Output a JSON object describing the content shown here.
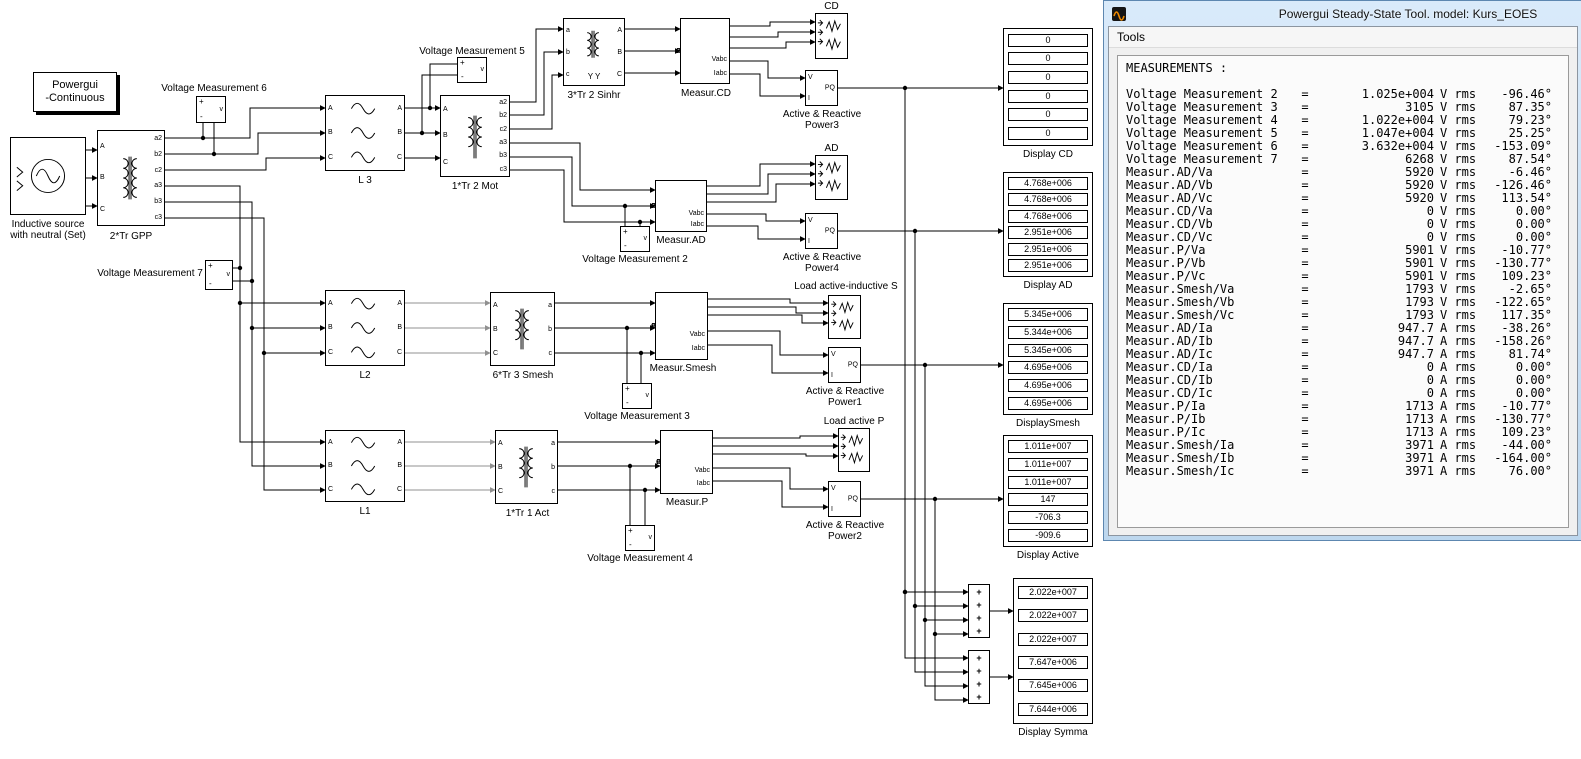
{
  "diagram": {
    "powergui": {
      "line1": "Powergui",
      "line2": "-Continuous"
    },
    "source": {
      "line1": "Inductive source",
      "line2": "with neutral (Set)"
    },
    "gpp": {
      "label": "2*Tr GPP"
    },
    "abc": [
      "A",
      "B",
      "C"
    ],
    "abc_lower": [
      "a",
      "b",
      "c"
    ],
    "tr6": [
      "a2",
      "b2",
      "c2",
      "a3",
      "b3",
      "c3"
    ],
    "vm_pins": {
      "plus": "+",
      "minus": "-",
      "out": "v"
    },
    "vm2_label": "Voltage Measurement 2",
    "vm3_label": "Voltage Measurement 3",
    "vm4_label": "Voltage Measurement 4",
    "vm5_label": "Voltage Measurement 5",
    "vm6_label": "Voltage Measurement 6",
    "vm7_label": "Voltage Measurement 7",
    "l3_label": "L 3",
    "l2_label": "L2",
    "l1_label": "L1",
    "tr2mot": {
      "label": "1*Tr 2 Mot"
    },
    "tr2sinhr": {
      "label": "3*Tr 2 Sinhr",
      "winding": "Y Y"
    },
    "tr3smesh": {
      "label": "6*Tr 3 Smesh"
    },
    "tr1act": {
      "label": "1*Tr 1 Act"
    },
    "measur_pins": {
      "vabc": "Vabc",
      "iabc": "Iabc"
    },
    "measur_cd_label": "Measur.CD",
    "measur_ad_label": "Measur.AD",
    "measur_smesh_label": "Measur.Smesh",
    "measur_p_label": "Measur.P",
    "scope_cd_label": "CD",
    "scope_ad_label": "AD",
    "load_s_label": "Load active-inductive  S",
    "load_p_label": "Load active P",
    "power_pins": {
      "v": "V",
      "i": "I",
      "pq": "PQ"
    },
    "power1": {
      "line1": "Active & Reactive",
      "line2": "Power1"
    },
    "power2": {
      "line1": "Active & Reactive",
      "line2": "Power2"
    },
    "power3": {
      "line1": "Active & Reactive",
      "line2": "Power3"
    },
    "power4": {
      "line1": "Active & Reactive",
      "line2": "Power4"
    },
    "sum_signs": [
      "+",
      "+",
      "+",
      "+"
    ]
  },
  "displays": {
    "cd": {
      "label": "Display CD",
      "values": [
        "0",
        "0",
        "0",
        "0",
        "0",
        "0"
      ]
    },
    "ad": {
      "label": "Display AD",
      "values": [
        "4.768e+006",
        "4.768e+006",
        "4.768e+006",
        "2.951e+006",
        "2.951e+006",
        "2.951e+006"
      ]
    },
    "smesh": {
      "label": "DisplaySmesh",
      "values": [
        "5.345e+006",
        "5.344e+006",
        "5.345e+006",
        "4.695e+006",
        "4.695e+006",
        "4.695e+006"
      ]
    },
    "active": {
      "label": "Display Active",
      "values": [
        "1.011e+007",
        "1.011e+007",
        "1.011e+007",
        "147",
        "-706.3",
        "-909.6"
      ]
    },
    "symma": {
      "label": "Display Symma",
      "values": [
        "2.022e+007",
        "2.022e+007",
        "2.022e+007",
        "7.647e+006",
        "7.645e+006",
        "7.644e+006"
      ]
    }
  },
  "tool_window": {
    "title": "Powergui Steady-State Tool. model: Kurs_EOES",
    "menu_items": [
      "Tools"
    ],
    "header": "MEASUREMENTS :",
    "eq": "=",
    "measurements": [
      {
        "name": "Voltage Measurement 2",
        "value": "1.025e+004",
        "unit": "V rms",
        "angle": "-96.46°"
      },
      {
        "name": "Voltage Measurement 3",
        "value": "3105",
        "unit": "V rms",
        "angle": "87.35°"
      },
      {
        "name": "Voltage Measurement 4",
        "value": "1.022e+004",
        "unit": "V rms",
        "angle": "79.23°"
      },
      {
        "name": "Voltage Measurement 5",
        "value": "1.047e+004",
        "unit": "V rms",
        "angle": "25.25°"
      },
      {
        "name": "Voltage Measurement 6",
        "value": "3.632e+004",
        "unit": "V rms",
        "angle": "-153.09°"
      },
      {
        "name": "Voltage Measurement 7",
        "value": "6268",
        "unit": "V rms",
        "angle": "87.54°"
      },
      {
        "name": "Measur.AD/Va",
        "value": "5920",
        "unit": "V rms",
        "angle": "-6.46°"
      },
      {
        "name": "Measur.AD/Vb",
        "value": "5920",
        "unit": "V rms",
        "angle": "-126.46°"
      },
      {
        "name": "Measur.AD/Vc",
        "value": "5920",
        "unit": "V rms",
        "angle": "113.54°"
      },
      {
        "name": "Measur.CD/Va",
        "value": "0",
        "unit": "V rms",
        "angle": "0.00°"
      },
      {
        "name": "Measur.CD/Vb",
        "value": "0",
        "unit": "V rms",
        "angle": "0.00°"
      },
      {
        "name": "Measur.CD/Vc",
        "value": "0",
        "unit": "V rms",
        "angle": "0.00°"
      },
      {
        "name": "Measur.P/Va",
        "value": "5901",
        "unit": "V rms",
        "angle": "-10.77°"
      },
      {
        "name": "Measur.P/Vb",
        "value": "5901",
        "unit": "V rms",
        "angle": "-130.77°"
      },
      {
        "name": "Measur.P/Vc",
        "value": "5901",
        "unit": "V rms",
        "angle": "109.23°"
      },
      {
        "name": "Measur.Smesh/Va",
        "value": "1793",
        "unit": "V rms",
        "angle": "-2.65°"
      },
      {
        "name": "Measur.Smesh/Vb",
        "value": "1793",
        "unit": "V rms",
        "angle": "-122.65°"
      },
      {
        "name": "Measur.Smesh/Vc",
        "value": "1793",
        "unit": "V rms",
        "angle": "117.35°"
      },
      {
        "name": "Measur.AD/Ia",
        "value": "947.7",
        "unit": "A rms",
        "angle": "-38.26°"
      },
      {
        "name": "Measur.AD/Ib",
        "value": "947.7",
        "unit": "A rms",
        "angle": "-158.26°"
      },
      {
        "name": "Measur.AD/Ic",
        "value": "947.7",
        "unit": "A rms",
        "angle": "81.74°"
      },
      {
        "name": "Measur.CD/Ia",
        "value": "0",
        "unit": "A rms",
        "angle": "0.00°"
      },
      {
        "name": "Measur.CD/Ib",
        "value": "0",
        "unit": "A rms",
        "angle": "0.00°"
      },
      {
        "name": "Measur.CD/Ic",
        "value": "0",
        "unit": "A rms",
        "angle": "0.00°"
      },
      {
        "name": "Measur.P/Ia",
        "value": "1713",
        "unit": "A rms",
        "angle": "-10.77°"
      },
      {
        "name": "Measur.P/Ib",
        "value": "1713",
        "unit": "A rms",
        "angle": "-130.77°"
      },
      {
        "name": "Measur.P/Ic",
        "value": "1713",
        "unit": "A rms",
        "angle": "109.23°"
      },
      {
        "name": "Measur.Smesh/Ia",
        "value": "3971",
        "unit": "A rms",
        "angle": "-44.00°"
      },
      {
        "name": "Measur.Smesh/Ib",
        "value": "3971",
        "unit": "A rms",
        "angle": "-164.00°"
      },
      {
        "name": "Measur.Smesh/Ic",
        "value": "3971",
        "unit": "A rms",
        "angle": "76.00°"
      }
    ]
  }
}
